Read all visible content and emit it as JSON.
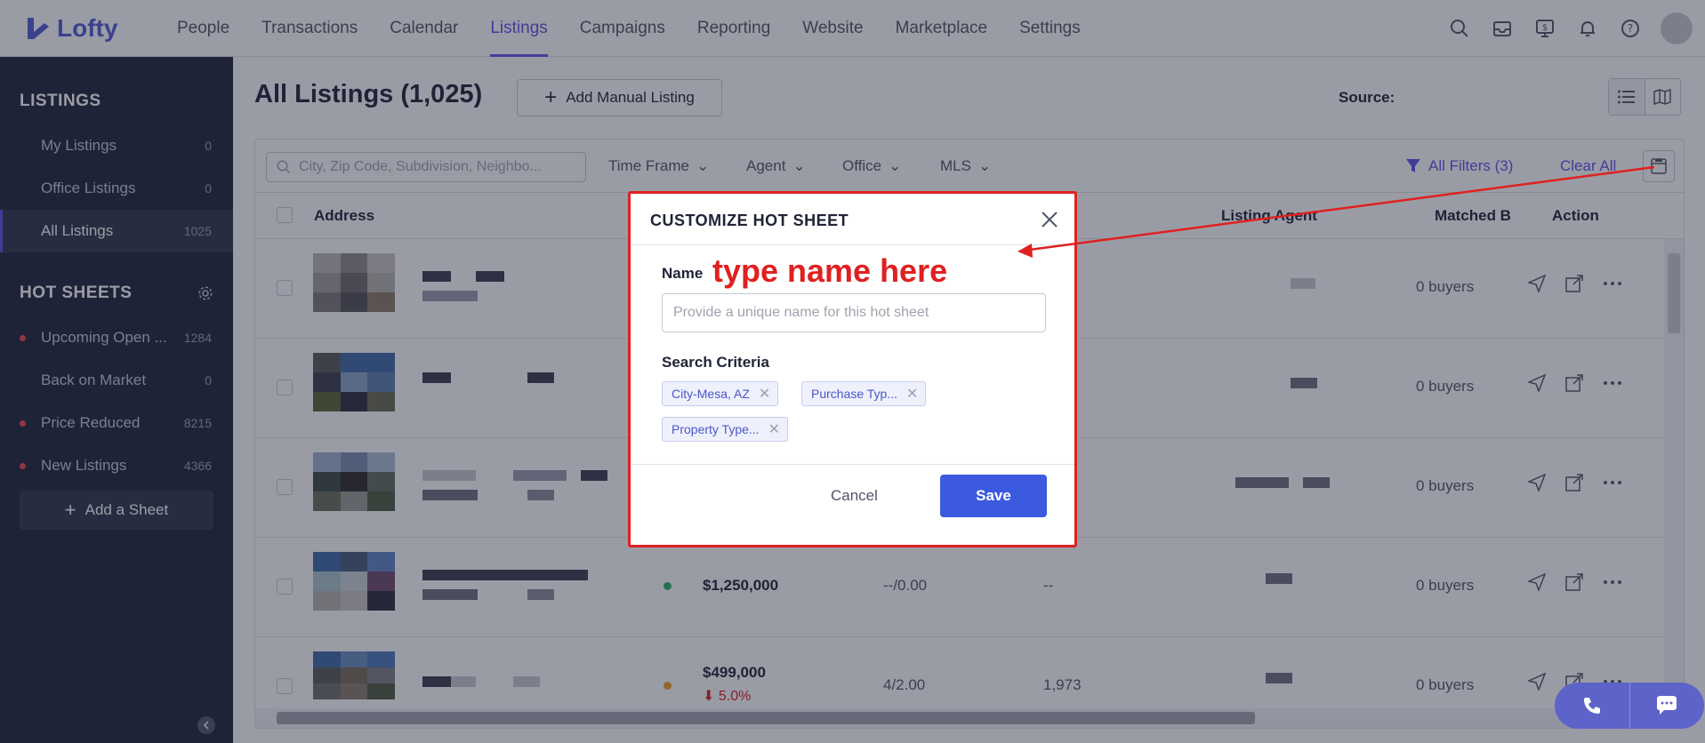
{
  "app": {
    "brand": "Lofty"
  },
  "nav": {
    "items": [
      {
        "label": "People"
      },
      {
        "label": "Transactions"
      },
      {
        "label": "Calendar"
      },
      {
        "label": "Listings",
        "active": true
      },
      {
        "label": "Campaigns"
      },
      {
        "label": "Reporting"
      },
      {
        "label": "Website"
      },
      {
        "label": "Marketplace"
      },
      {
        "label": "Settings"
      }
    ],
    "icons": [
      "search-icon",
      "inbox-icon",
      "dollar-monitor-icon",
      "bell-icon",
      "help-icon",
      "avatar"
    ]
  },
  "sidebar": {
    "listings_heading": "LISTINGS",
    "listings": [
      {
        "label": "My Listings",
        "count": "0"
      },
      {
        "label": "Office Listings",
        "count": "0"
      },
      {
        "label": "All Listings",
        "count": "1025",
        "active": true
      }
    ],
    "hotsheets_heading": "HOT SHEETS",
    "hotsheets": [
      {
        "label": "Upcoming Open ...",
        "count": "1284",
        "dot": true
      },
      {
        "label": "Back on Market",
        "count": "0",
        "dot": false
      },
      {
        "label": "Price Reduced",
        "count": "8215",
        "dot": true
      },
      {
        "label": "New Listings",
        "count": "4366",
        "dot": true
      }
    ],
    "add_sheet": "Add a Sheet"
  },
  "main": {
    "title": "All Listings (1,025)",
    "add_manual": "Add Manual Listing",
    "source_label": "Source:",
    "search_placeholder": "City, Zip Code, Subdivision, Neighbo...",
    "filters": [
      "Time Frame",
      "Agent",
      "Office",
      "MLS"
    ],
    "all_filters": "All Filters (3)",
    "clear_all": "Clear All",
    "columns": {
      "address": "Address",
      "listing_agent": "Listing Agent",
      "matched": "Matched B",
      "action": "Action"
    },
    "rows": [
      {
        "buyers": "0 buyers"
      },
      {
        "buyers": "0 buyers"
      },
      {
        "buyers": "0 buyers"
      },
      {
        "buyers": "0 buyers",
        "price": "$1,250,000",
        "beds_baths": "--/0.00",
        "sqft": "--",
        "status_color": "#2eaf6a"
      },
      {
        "buyers": "0 buyers",
        "price": "$499,000",
        "change": "5.0%",
        "beds_baths": "4/2.00",
        "sqft": "1,973",
        "status_color": "#f0a020"
      }
    ]
  },
  "modal": {
    "title": "CUSTOMIZE HOT SHEET",
    "name_label": "Name",
    "name_placeholder": "Provide a unique name for this hot sheet",
    "annotation": "type name here",
    "criteria_label": "Search Criteria",
    "chips": [
      "City-Mesa, AZ",
      "Purchase Typ...",
      "Property Type..."
    ],
    "cancel": "Cancel",
    "save": "Save"
  },
  "colors": {
    "accent": "#5d51e8",
    "primary_button": "#3b5ae0",
    "annotation_red": "#e02020",
    "sidebar_bg": "#202437"
  }
}
